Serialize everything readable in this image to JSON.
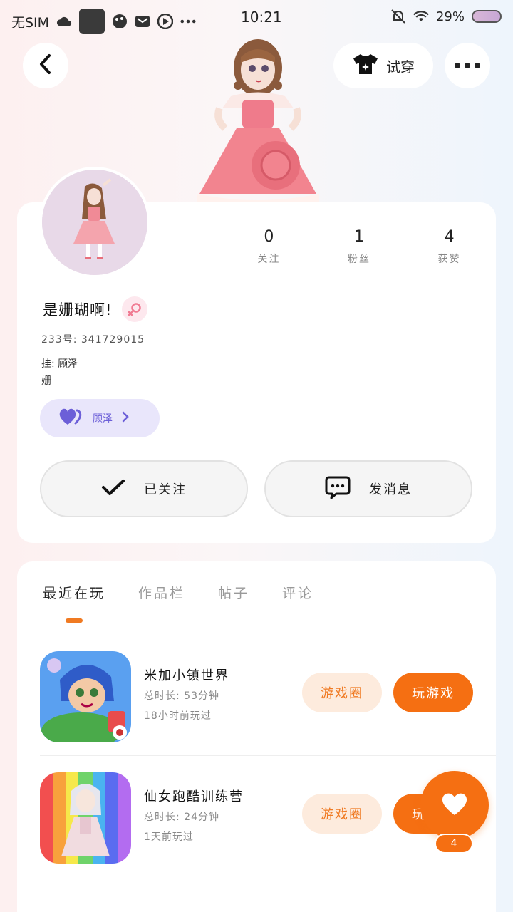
{
  "status_bar": {
    "carrier": "无SIM",
    "time": "10:21",
    "battery": "29%",
    "icons": [
      "cloud-icon",
      "app-square-icon",
      "palette-icon",
      "mail-icon",
      "play-icon",
      "more-dots-icon",
      "mute-icon",
      "wifi-icon",
      "battery-icon"
    ]
  },
  "header": {
    "try_on_label": "试穿",
    "icons": [
      "back-icon",
      "tshirt-icon",
      "more-icon"
    ]
  },
  "profile": {
    "stats": [
      {
        "value": "0",
        "label": "关注"
      },
      {
        "value": "1",
        "label": "粉丝"
      },
      {
        "value": "4",
        "label": "获赞"
      }
    ],
    "name": "是姗瑚啊!",
    "gender_icon": "female-icon",
    "uid": "233号: 341729015",
    "bio_line1": "挂: 顾泽",
    "bio_line2": "姗",
    "cp_name": "顾泽",
    "follow_label": "已关注",
    "message_label": "发消息"
  },
  "tabs": [
    {
      "label": "最近在玩",
      "active": true
    },
    {
      "label": "作品栏",
      "active": false
    },
    {
      "label": "帖子",
      "active": false
    },
    {
      "label": "评论",
      "active": false
    }
  ],
  "games": [
    {
      "name": "米加小镇世界",
      "duration": "总时长: 53分钟",
      "last_played": "18小时前玩过",
      "circle_label": "游戏圈",
      "play_label": "玩游戏"
    },
    {
      "name": "仙女跑酷训练营",
      "duration": "总时长: 24分钟",
      "last_played": "1天前玩过",
      "circle_label": "游戏圈",
      "play_label": "玩游戏"
    }
  ],
  "like_fab": {
    "count": "4",
    "icon": "heart-icon"
  },
  "colors": {
    "accent": "#f56f12",
    "accent_light": "#fdebdd",
    "cp_chip": "#e9e6fb",
    "cp_text": "#6c5fd8"
  }
}
